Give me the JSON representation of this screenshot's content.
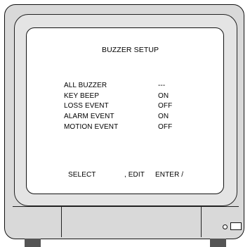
{
  "menu": {
    "title": "BUZZER SETUP",
    "items": [
      {
        "label": "ALL  BUZZER",
        "value": "---"
      },
      {
        "label": "KEY BEEP",
        "value": "ON"
      },
      {
        "label": "LOSS EVENT",
        "value": "OFF"
      },
      {
        "label": "ALARM EVENT",
        "value": "ON"
      },
      {
        "label": "MOTION EVENT",
        "value": "OFF"
      }
    ],
    "footer": {
      "select": "SELECT",
      "edit": ", EDIT",
      "enter": "ENTER /"
    }
  },
  "colors": {
    "case": "#d9d9d9",
    "screen": "#ffffff",
    "feet": "#555555"
  }
}
